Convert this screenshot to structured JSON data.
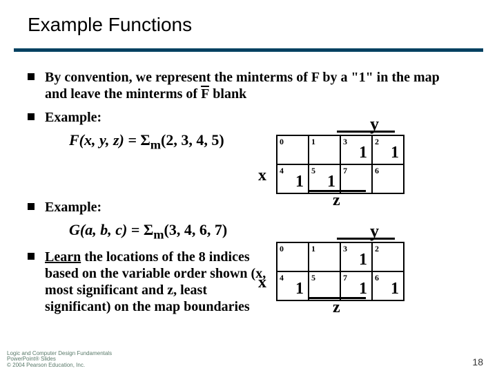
{
  "title": "Example Functions",
  "bullets": {
    "b1a": "By convention, we represent the minterms of F by a \"1\" in the map and leave the minterms of ",
    "b1_fbar": "F",
    "b1b": " blank",
    "b2": "Example:",
    "b3": "Example:",
    "b4a": "Learn",
    "b4b": " the locations of the 8 indices based on the variable order shown (x, most significant and z, least significant) on the map boundaries"
  },
  "formulas": {
    "f1_lhs": "F(x, y, z) = ",
    "f1_sigma": "Σ",
    "f1_sub": "m",
    "f1_args": "(2, 3, 4, 5)",
    "g1_lhs": "G(a, b, c) = ",
    "g1_sigma": "Σ",
    "g1_sub": "m",
    "g1_args": "(3, 4, 6, 7)"
  },
  "kmap_labels": {
    "x": "x",
    "y": "y",
    "z": "z"
  },
  "kmap1": {
    "cells": [
      [
        {
          "idx": "0",
          "val": ""
        },
        {
          "idx": "1",
          "val": ""
        },
        {
          "idx": "3",
          "val": "1"
        },
        {
          "idx": "2",
          "val": "1"
        }
      ],
      [
        {
          "idx": "4",
          "val": "1"
        },
        {
          "idx": "5",
          "val": "1"
        },
        {
          "idx": "7",
          "val": ""
        },
        {
          "idx": "6",
          "val": ""
        }
      ]
    ]
  },
  "kmap2": {
    "cells": [
      [
        {
          "idx": "0",
          "val": ""
        },
        {
          "idx": "1",
          "val": ""
        },
        {
          "idx": "3",
          "val": "1"
        },
        {
          "idx": "2",
          "val": ""
        }
      ],
      [
        {
          "idx": "4",
          "val": "1"
        },
        {
          "idx": "5",
          "val": ""
        },
        {
          "idx": "7",
          "val": "1"
        },
        {
          "idx": "6",
          "val": "1"
        }
      ]
    ]
  },
  "footer": {
    "line1": "Logic and Computer Design Fundamentals",
    "line2": "PowerPoint® Slides",
    "line3": "© 2004 Pearson Education, Inc."
  },
  "pagenum": "18"
}
